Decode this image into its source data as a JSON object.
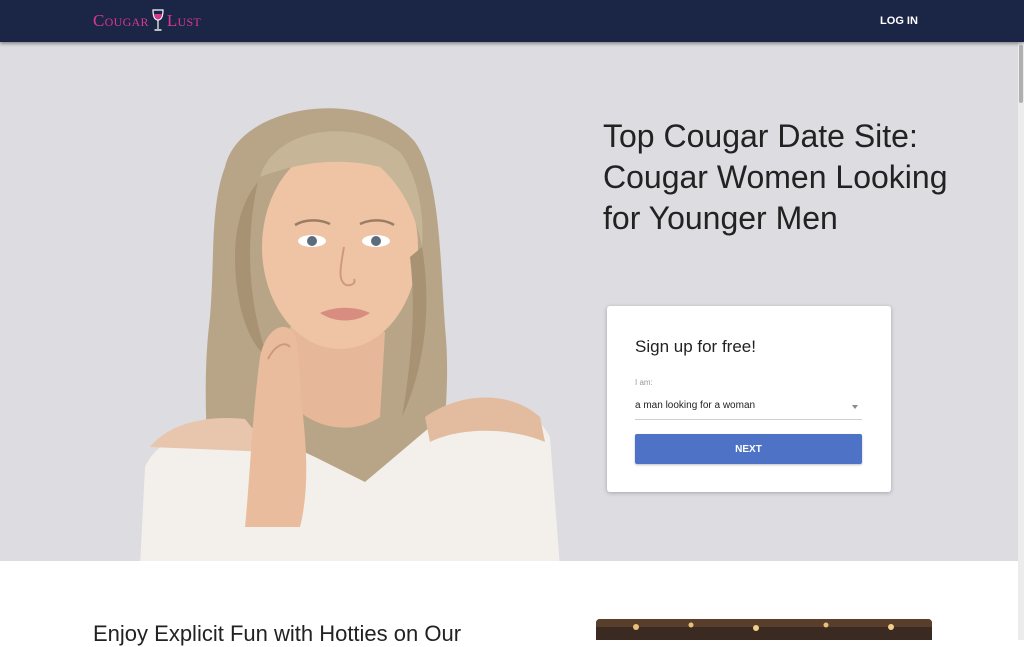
{
  "nav": {
    "logo_left": "Cougar",
    "logo_right": "Lust",
    "login_label": "LOG IN"
  },
  "hero": {
    "headline": "Top Cougar Date Site: Cougar Women Looking for Younger Men"
  },
  "signup": {
    "title": "Sign up for free!",
    "field_label": "I am:",
    "select_value": "a man looking for a woman",
    "next_label": "NEXT"
  },
  "section": {
    "heading": "Enjoy Explicit Fun with Hotties on Our"
  },
  "colors": {
    "navbar": "#1b2646",
    "logo": "#d9388f",
    "hero_bg": "#dcdce1",
    "button": "#4e72c5"
  },
  "icons": {
    "logo_glass": "wine-glass-icon",
    "select_caret": "caret-down-icon"
  }
}
